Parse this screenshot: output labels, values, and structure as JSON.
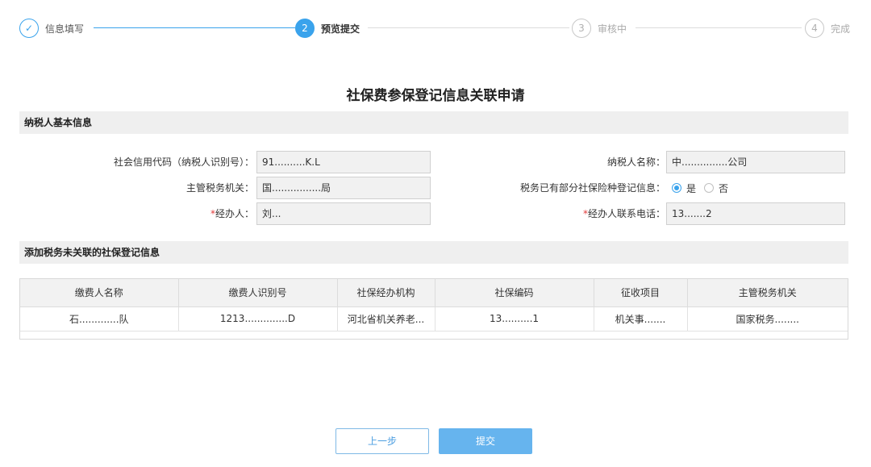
{
  "stepper": {
    "steps": [
      {
        "label": "信息填写",
        "marker": "✓",
        "state": "done"
      },
      {
        "label": "预览提交",
        "marker": "2",
        "state": "active"
      },
      {
        "label": "审核中",
        "marker": "3",
        "state": "todo"
      },
      {
        "label": "完成",
        "marker": "4",
        "state": "todo"
      }
    ]
  },
  "title": "社保费参保登记信息关联申请",
  "section1": {
    "title": "纳税人基本信息",
    "credit_code_label": "社会信用代码（纳税人识别号）：",
    "credit_code_value": "91..........K.L",
    "taxpayer_name_label": "纳税人名称：",
    "taxpayer_name_value": "中...............公司",
    "tax_office_label": "主管税务机关：",
    "tax_office_value": "国................局",
    "registered_label": "税务已有部分社保险种登记信息：",
    "radio_yes": "是",
    "radio_no": "否",
    "agent_label": "经办人：",
    "agent_value": "刘...",
    "agent_phone_label": "经办人联系电话：",
    "agent_phone_value": "13.......2",
    "required_mark": "*"
  },
  "section2": {
    "title": "添加税务未关联的社保登记信息",
    "columns": [
      "缴费人名称",
      "缴费人识别号",
      "社保经办机构",
      "社保编码",
      "征收项目",
      "主管税务机关"
    ],
    "rows": [
      [
        "石.............队",
        "1213..............D",
        "河北省机关养老...",
        "13..........1",
        "机关事.......",
        "国家税务........"
      ]
    ]
  },
  "buttons": {
    "prev": "上一步",
    "submit": "提交"
  },
  "colors": {
    "accent": "#3aa3ec",
    "required": "#e23b3b"
  }
}
